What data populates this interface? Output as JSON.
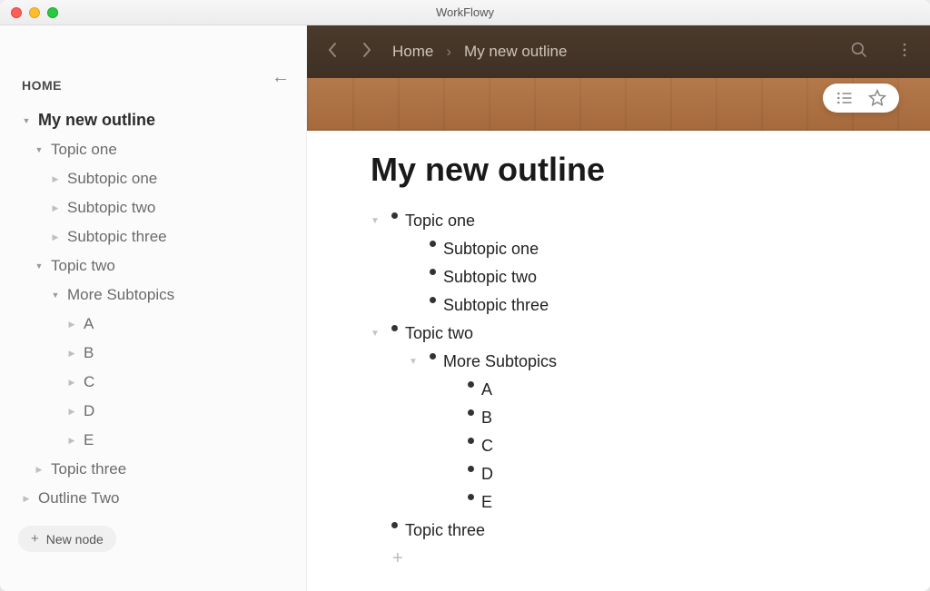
{
  "window": {
    "title": "WorkFlowy"
  },
  "sidebar": {
    "home_label": "HOME",
    "collapse_glyph": "←",
    "tree": [
      {
        "label": "My new outline",
        "caret": "down",
        "bold": true,
        "indent": 0
      },
      {
        "label": "Topic one",
        "caret": "down",
        "indent": 1
      },
      {
        "label": "Subtopic one",
        "caret": "right",
        "indent": 2
      },
      {
        "label": "Subtopic two",
        "caret": "right",
        "indent": 2
      },
      {
        "label": "Subtopic three",
        "caret": "right",
        "indent": 2
      },
      {
        "label": "Topic two",
        "caret": "down",
        "indent": 1
      },
      {
        "label": "More Subtopics",
        "caret": "down",
        "indent": 2
      },
      {
        "label": "A",
        "caret": "right",
        "indent": 3
      },
      {
        "label": "B",
        "caret": "right",
        "indent": 3
      },
      {
        "label": "C",
        "caret": "right",
        "indent": 3
      },
      {
        "label": "D",
        "caret": "right",
        "indent": 3
      },
      {
        "label": "E",
        "caret": "right",
        "indent": 3
      },
      {
        "label": "Topic three",
        "caret": "right",
        "indent": 1
      },
      {
        "label": "Outline Two",
        "caret": "right",
        "indent": 0
      }
    ],
    "new_node_label": "New node"
  },
  "topbar": {
    "breadcrumb": [
      "Home",
      "My new outline"
    ]
  },
  "doc": {
    "title": "My new outline",
    "outline": [
      {
        "text": "Topic one",
        "level": 0,
        "caret": true
      },
      {
        "text": "Subtopic one",
        "level": 1
      },
      {
        "text": "Subtopic two",
        "level": 1
      },
      {
        "text": "Subtopic three",
        "level": 1
      },
      {
        "text": "Topic two",
        "level": 0,
        "caret": true
      },
      {
        "text": "More Subtopics",
        "level": 1,
        "caret": true
      },
      {
        "text": "A",
        "level": 2
      },
      {
        "text": "B",
        "level": 2
      },
      {
        "text": "C",
        "level": 2
      },
      {
        "text": "D",
        "level": 2
      },
      {
        "text": "E",
        "level": 2
      },
      {
        "text": "Topic three",
        "level": 0
      }
    ]
  }
}
